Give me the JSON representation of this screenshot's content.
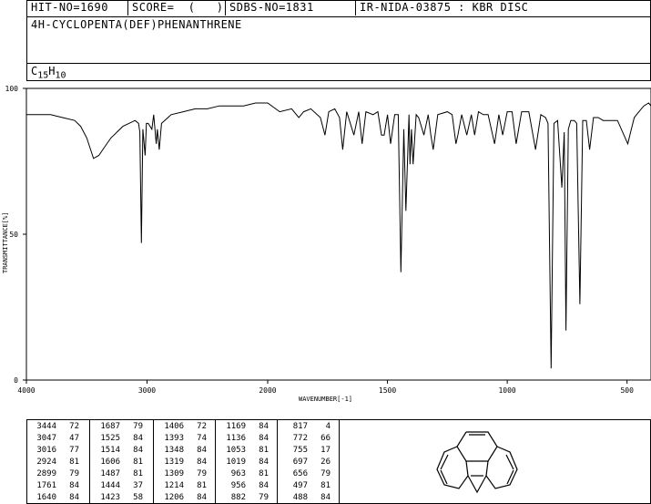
{
  "header": {
    "hit_no": "HIT-NO=1690",
    "score": "SCORE=  (   )",
    "sdbs_no": "SDBS-NO=1831",
    "ir_info": "IR-NIDA-03875 : KBR DISC"
  },
  "compound": {
    "name": "4H-CYCLOPENTA(DEF)PHENANTHRENE",
    "formula_c": "C",
    "formula_c_sub": "15",
    "formula_h": "H",
    "formula_h_sub": "10"
  },
  "chart_data": {
    "type": "line",
    "xlabel": "WAVENUMBER[-1]",
    "ylabel": "TRANSMITTANCE[%]",
    "xlim": [
      4000,
      400
    ],
    "ylim": [
      0,
      100
    ],
    "x_ticks": [
      "4000",
      "3000",
      "2000",
      "1500",
      "1000",
      "500"
    ],
    "y_ticks": [
      "0",
      "50",
      "100"
    ],
    "grid": false,
    "series": [
      {
        "x": [
          4000,
          3900,
          3800,
          3700,
          3600,
          3550,
          3500,
          3444,
          3400,
          3350,
          3300,
          3250,
          3200,
          3150,
          3100,
          3070,
          3060,
          3047,
          3035,
          3016,
          3005,
          2990,
          2960,
          2945,
          2924,
          2915,
          2899,
          2880,
          2800,
          2700,
          2600,
          2500,
          2400,
          2300,
          2200,
          2100,
          2000,
          1950,
          1900,
          1870,
          1850,
          1820,
          1780,
          1761,
          1745,
          1720,
          1700,
          1687,
          1670,
          1640,
          1620,
          1606,
          1590,
          1560,
          1540,
          1525,
          1514,
          1500,
          1487,
          1470,
          1455,
          1444,
          1432,
          1423,
          1410,
          1406,
          1400,
          1393,
          1380,
          1370,
          1348,
          1330,
          1319,
          1309,
          1290,
          1250,
          1230,
          1214,
          1206,
          1190,
          1169,
          1150,
          1136,
          1120,
          1100,
          1080,
          1053,
          1035,
          1019,
          1000,
          980,
          963,
          940,
          910,
          882,
          860,
          840,
          830,
          817,
          805,
          790,
          772,
          762,
          755,
          745,
          735,
          720,
          710,
          697,
          685,
          670,
          656,
          640,
          620,
          600,
          570,
          540,
          497,
          488,
          470,
          450,
          430,
          410,
          400
        ],
        "y": [
          91,
          91,
          91,
          90,
          89,
          87,
          83,
          76,
          77,
          80,
          83,
          85,
          87,
          88,
          89,
          88,
          85,
          47,
          86,
          77,
          88,
          88,
          86,
          91,
          81,
          86,
          79,
          88,
          91,
          92,
          93,
          93,
          94,
          94,
          94,
          95,
          95,
          92,
          93,
          90,
          92,
          93,
          90,
          84,
          92,
          93,
          90,
          79,
          92,
          84,
          92,
          81,
          92,
          91,
          92,
          84,
          84,
          91,
          81,
          91,
          91,
          37,
          86,
          58,
          91,
          74,
          86,
          74,
          91,
          90,
          84,
          91,
          84,
          79,
          91,
          92,
          91,
          81,
          84,
          91,
          84,
          91,
          84,
          92,
          91,
          91,
          81,
          91,
          84,
          92,
          92,
          81,
          92,
          92,
          79,
          91,
          90,
          88,
          4,
          88,
          89,
          66,
          85,
          17,
          86,
          89,
          89,
          88,
          26,
          89,
          89,
          79,
          90,
          90,
          89,
          89,
          89,
          81,
          84,
          90,
          92,
          94,
          95,
          94
        ]
      }
    ],
    "peaks": [
      {
        "wn": "3444",
        "t": "72"
      },
      {
        "wn": "3047",
        "t": "47"
      },
      {
        "wn": "3016",
        "t": "77"
      },
      {
        "wn": "2924",
        "t": "81"
      },
      {
        "wn": "2899",
        "t": "79"
      },
      {
        "wn": "1761",
        "t": "84"
      },
      {
        "wn": "1640",
        "t": "84"
      },
      {
        "wn": "1687",
        "t": "79"
      },
      {
        "wn": "1525",
        "t": "84"
      },
      {
        "wn": "1514",
        "t": "84"
      },
      {
        "wn": "1606",
        "t": "81"
      },
      {
        "wn": "1487",
        "t": "81"
      },
      {
        "wn": "1444",
        "t": "37"
      },
      {
        "wn": "1423",
        "t": "58"
      },
      {
        "wn": "1406",
        "t": "72"
      },
      {
        "wn": "1393",
        "t": "74"
      },
      {
        "wn": "1348",
        "t": "84"
      },
      {
        "wn": "1319",
        "t": "84"
      },
      {
        "wn": "1309",
        "t": "79"
      },
      {
        "wn": "1214",
        "t": "81"
      },
      {
        "wn": "1206",
        "t": "84"
      },
      {
        "wn": "1169",
        "t": "84"
      },
      {
        "wn": "1136",
        "t": "84"
      },
      {
        "wn": "1053",
        "t": "81"
      },
      {
        "wn": "1019",
        "t": "84"
      },
      {
        "wn": "963",
        "t": "81"
      },
      {
        "wn": "956",
        "t": "84"
      },
      {
        "wn": "882",
        "t": "79"
      },
      {
        "wn": "817",
        "t": "4"
      },
      {
        "wn": "772",
        "t": "66"
      },
      {
        "wn": "755",
        "t": "17"
      },
      {
        "wn": "697",
        "t": "26"
      },
      {
        "wn": "656",
        "t": "79"
      },
      {
        "wn": "497",
        "t": "81"
      },
      {
        "wn": "488",
        "t": "84"
      }
    ]
  }
}
